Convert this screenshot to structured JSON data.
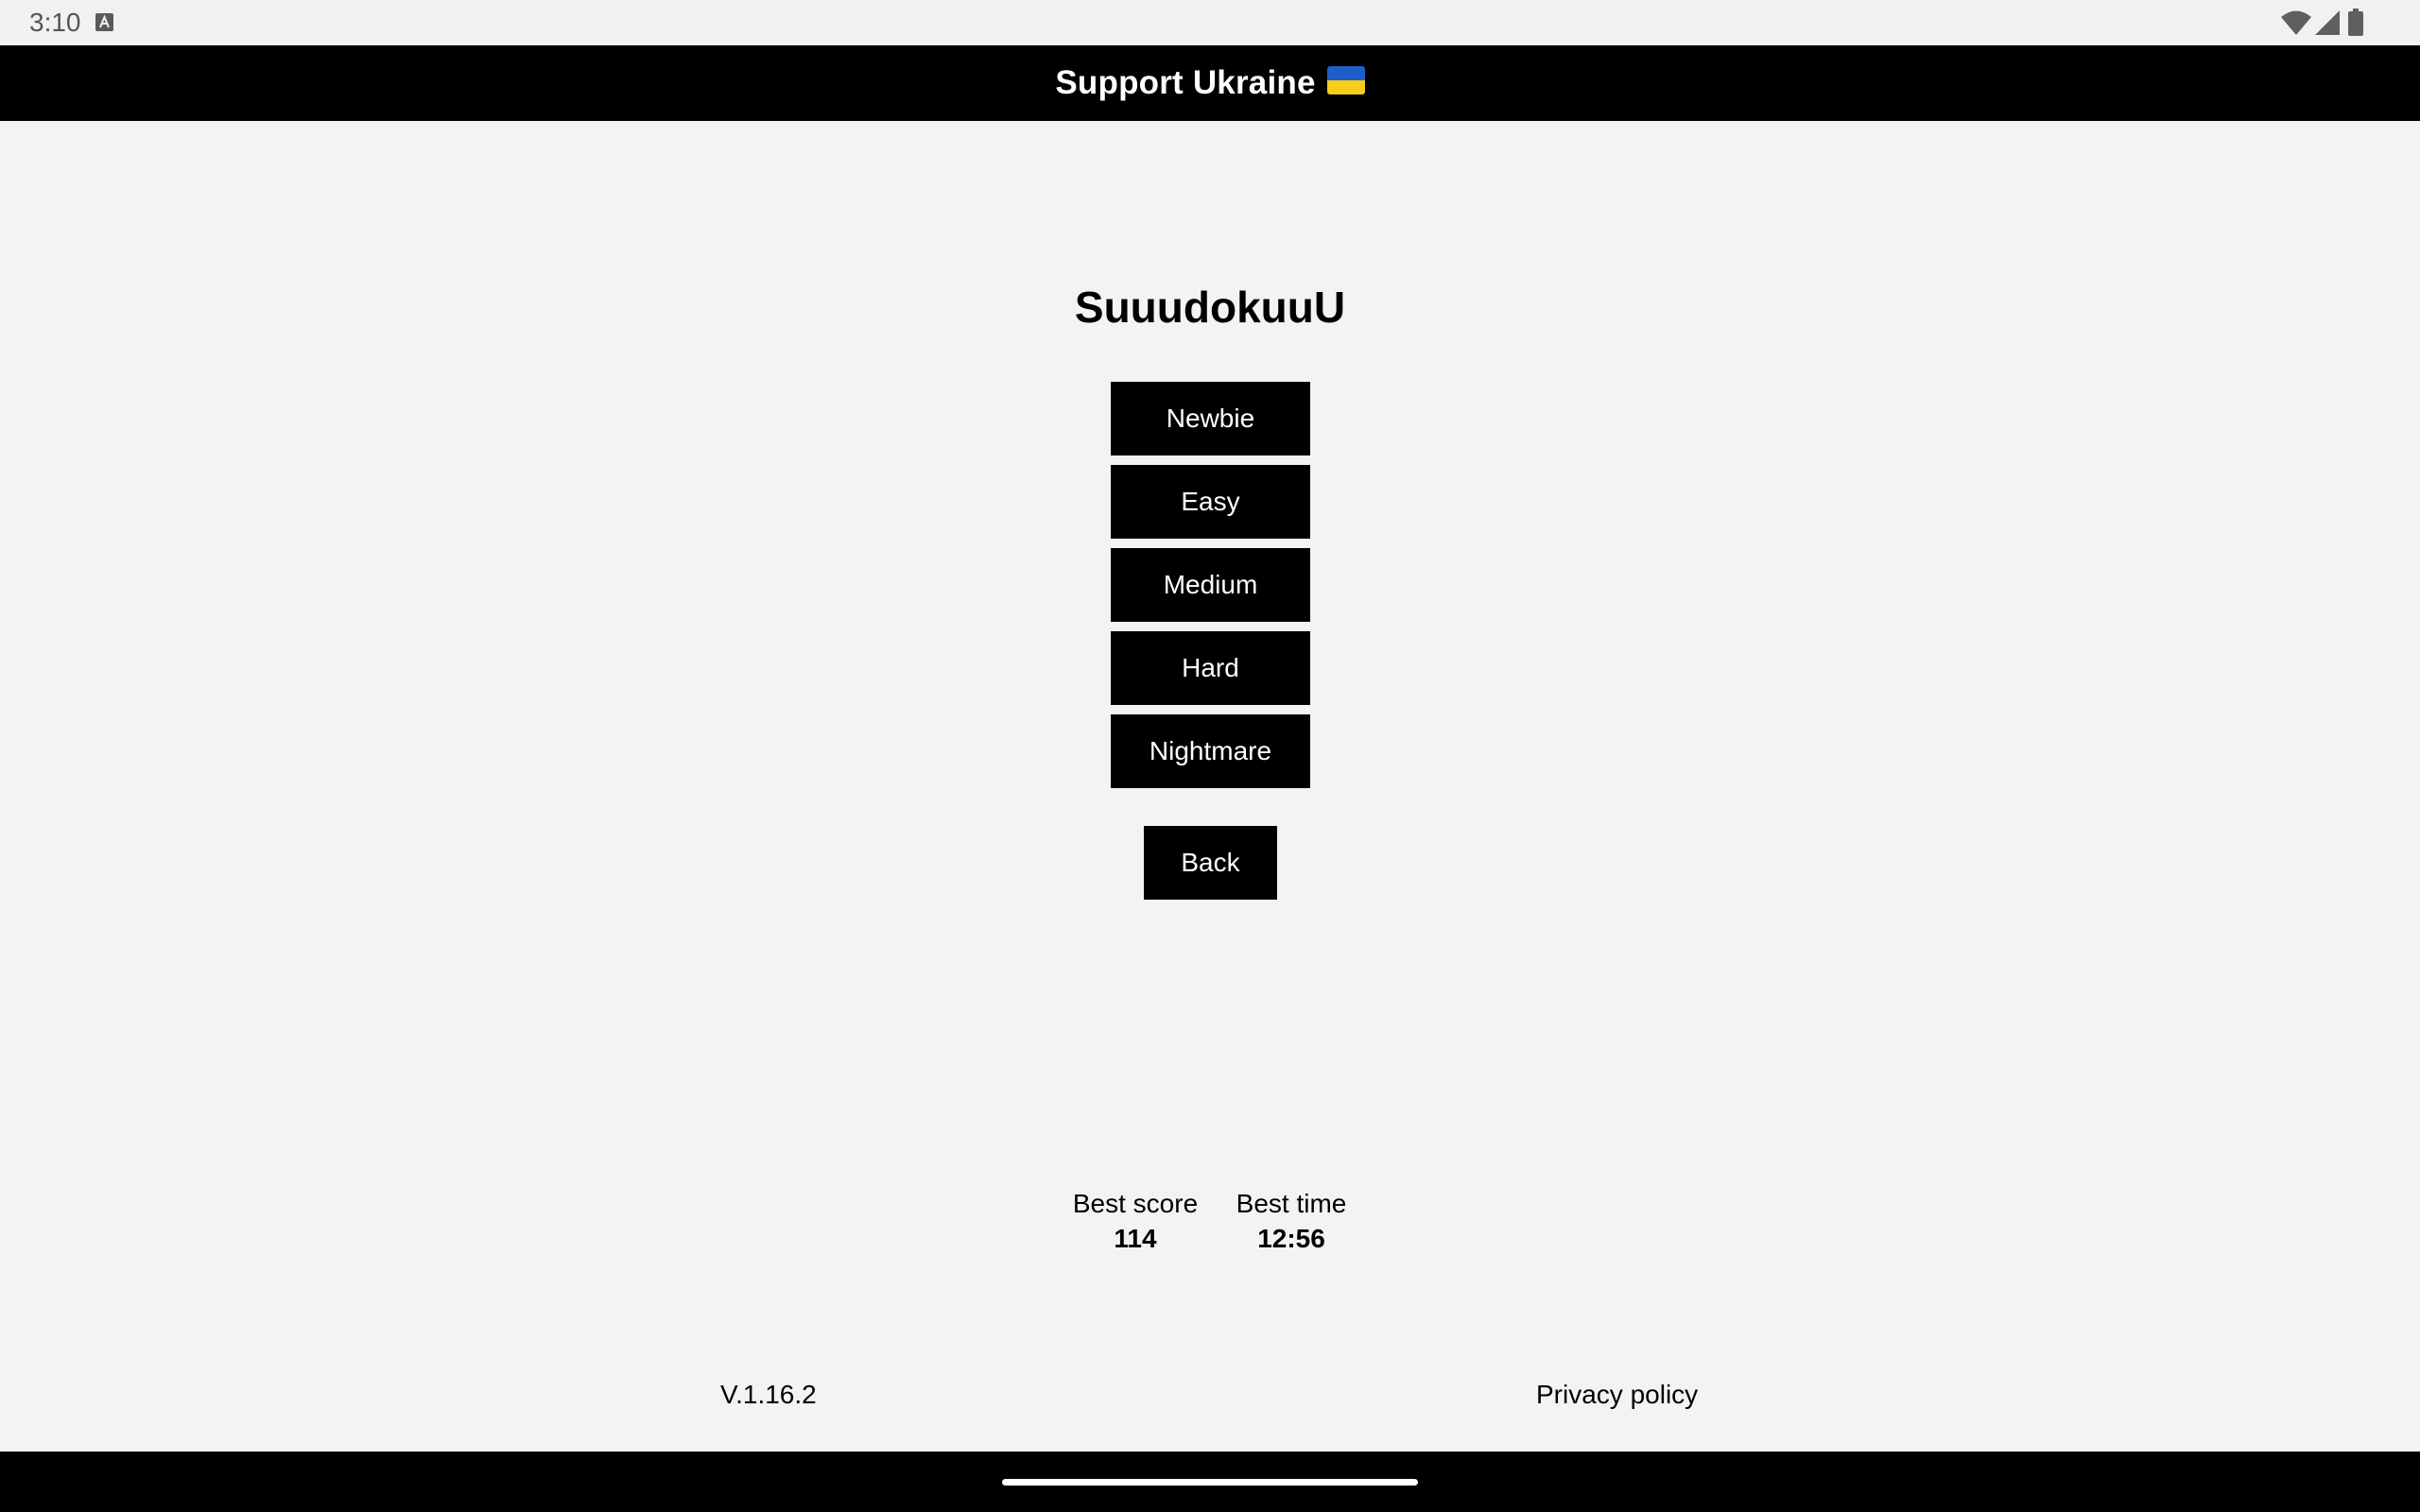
{
  "status_bar": {
    "time": "3:10",
    "icons": [
      "keyboard-a-icon",
      "wifi-icon",
      "cell-signal-icon",
      "battery-icon"
    ]
  },
  "banner": {
    "text": "Support Ukraine",
    "flag_colors": [
      "#1d5fc9",
      "#f7cc1a"
    ]
  },
  "app": {
    "title": "SuuudokuuU"
  },
  "levels": [
    {
      "label": "Newbie"
    },
    {
      "label": "Easy"
    },
    {
      "label": "Medium"
    },
    {
      "label": "Hard"
    },
    {
      "label": "Nightmare"
    }
  ],
  "back_label": "Back",
  "stats": {
    "best_score_label": "Best score",
    "best_score_value": "114",
    "best_time_label": "Best time",
    "best_time_value": "12:56"
  },
  "footer": {
    "version": "V.1.16.2",
    "privacy_label": "Privacy policy"
  },
  "colors": {
    "background": "#f3f3f3",
    "button": "#000000",
    "button_text": "#ffffff"
  }
}
